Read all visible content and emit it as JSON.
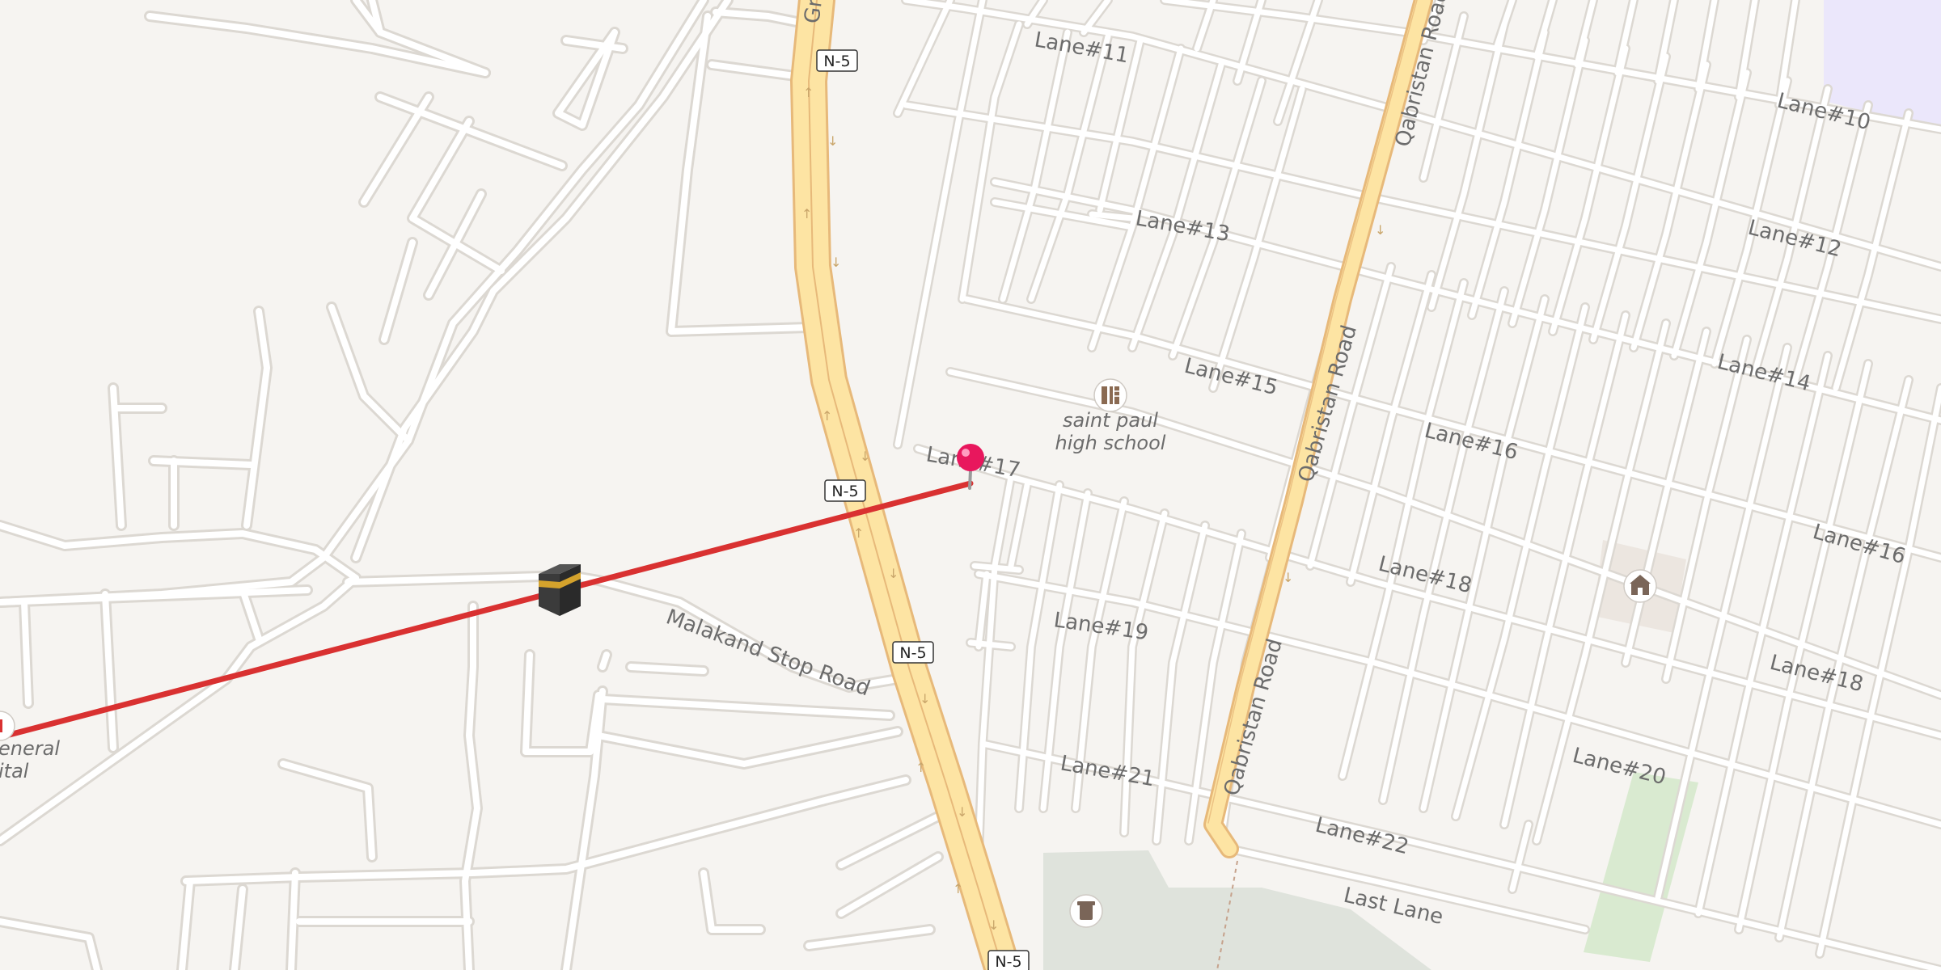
{
  "map": {
    "highway_shield": "N-5",
    "streets": {
      "lane11": "Lane#11",
      "lane10": "Lane#10",
      "lane13": "Lane#13",
      "lane12": "Lane#12",
      "lane15": "Lane#15",
      "lane14": "Lane#14",
      "lane16": "Lane#16",
      "lane16_east": "Lane#16",
      "lane17": "Lane#17",
      "lane18": "Lane#18",
      "lane18_east": "Lane#18",
      "lane19": "Lane#19",
      "lane20": "Lane#20",
      "lane21": "Lane#21",
      "lane22": "Lane#22",
      "last_lane": "Last Lane",
      "malakand": "Malakand Stop Road",
      "qabristan_top": "Qabristan Road",
      "qabristan_mid": "Qabristan Road",
      "qabristan_bottom": "Qabristan Road",
      "gt_partial": "Gr"
    },
    "poi": {
      "school_line1": "saint paul",
      "school_line2": "high school",
      "hospital_line1": "eneral",
      "hospital_line2": "ital"
    },
    "icons": {
      "school": "school-icon",
      "mosque": "kaaba-icon",
      "landmark": "building-icon",
      "cemetery": "cemetery-icon",
      "pin": "map-pin-icon",
      "hospital": "hospital-icon"
    },
    "colors": {
      "background": "#f6f4f1",
      "minor_road": "#ffffff",
      "minor_road_casing": "#dcd8d2",
      "highway_fill": "#fde4a3",
      "highway_casing": "#e7b97a",
      "route_line": "#d93131",
      "pin": "#e8175d",
      "park": "#d9ead0",
      "cemetery_area": "#dfe3dc",
      "residential_zone": "#ebe7fb"
    }
  }
}
